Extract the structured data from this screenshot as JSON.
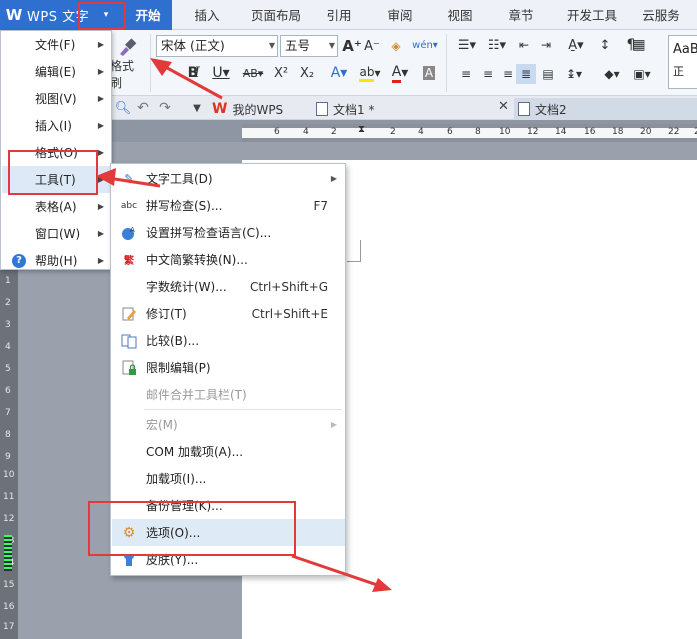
{
  "app": {
    "logo": "W",
    "name": "WPS 文字",
    "menu_arrow": "▾"
  },
  "tabs": [
    "开始",
    "插入",
    "页面布局",
    "引用",
    "审阅",
    "视图",
    "章节",
    "开发工具",
    "云服务"
  ],
  "active_tab": "开始",
  "ribbon": {
    "format_painter_label": "格式刷",
    "font_name": "宋体 (正文)",
    "font_size": "五号",
    "style_preview": "AaB",
    "style_preview_sub": "正"
  },
  "doc_tabs": [
    {
      "label": "我的WPS",
      "icon": "wps-logo-icon"
    },
    {
      "label": "文档1 *",
      "icon": "document-icon"
    },
    {
      "label": "文档2",
      "icon": "document-icon"
    }
  ],
  "ruler_h": [
    "6",
    "4",
    "2",
    "",
    "2",
    "4",
    "6",
    "8",
    "10",
    "12",
    "14",
    "16",
    "18",
    "20",
    "22",
    "24"
  ],
  "ruler_v": [
    "1",
    "2",
    "3",
    "4",
    "5",
    "6",
    "7",
    "8",
    "9",
    "10",
    "11",
    "12",
    "13",
    "14",
    "15",
    "16",
    "17"
  ],
  "app_menu": [
    {
      "label": "文件(F)",
      "submenu": true,
      "icon": ""
    },
    {
      "label": "编辑(E)",
      "submenu": true,
      "icon": ""
    },
    {
      "label": "视图(V)",
      "submenu": true,
      "icon": ""
    },
    {
      "label": "插入(I)",
      "submenu": true,
      "icon": ""
    },
    {
      "label": "格式(O)",
      "submenu": true,
      "icon": ""
    },
    {
      "label": "工具(T)",
      "submenu": true,
      "icon": "",
      "highlighted": true
    },
    {
      "label": "表格(A)",
      "submenu": true,
      "icon": ""
    },
    {
      "label": "窗口(W)",
      "submenu": true,
      "icon": ""
    },
    {
      "label": "帮助(H)",
      "submenu": true,
      "icon": "help-icon"
    }
  ],
  "tools_menu": [
    {
      "label": "文字工具(D)",
      "shortcut": "",
      "submenu": true,
      "icon": "text-tools-icon",
      "disabled": false
    },
    {
      "label": "拼写检查(S)...",
      "shortcut": "F7",
      "submenu": false,
      "icon": "spell-check-icon",
      "disabled": false
    },
    {
      "label": "设置拼写检查语言(C)...",
      "shortcut": "",
      "submenu": false,
      "icon": "language-icon",
      "disabled": false
    },
    {
      "label": "中文简繁转换(N)...",
      "shortcut": "",
      "submenu": false,
      "icon": "chinese-convert-icon",
      "disabled": false
    },
    {
      "label": "字数统计(W)...",
      "shortcut": "Ctrl+Shift+G",
      "submenu": false,
      "icon": "",
      "disabled": false
    },
    {
      "label": "修订(T)",
      "shortcut": "Ctrl+Shift+E",
      "submenu": false,
      "icon": "track-changes-icon",
      "disabled": false
    },
    {
      "label": "比较(B)...",
      "shortcut": "",
      "submenu": false,
      "icon": "compare-icon",
      "disabled": false
    },
    {
      "label": "限制编辑(P)",
      "shortcut": "",
      "submenu": false,
      "icon": "lock-icon",
      "disabled": false
    },
    {
      "label": "邮件合并工具栏(T)",
      "shortcut": "",
      "submenu": false,
      "icon": "",
      "disabled": true
    },
    {
      "label": "宏(M)",
      "shortcut": "",
      "submenu": true,
      "icon": "",
      "disabled": true
    },
    {
      "label": "COM 加载项(A)...",
      "shortcut": "",
      "submenu": false,
      "icon": "",
      "disabled": false
    },
    {
      "label": "加载项(I)...",
      "shortcut": "",
      "submenu": false,
      "icon": "",
      "disabled": false
    },
    {
      "label": "备份管理(K)...",
      "shortcut": "",
      "submenu": false,
      "icon": "",
      "disabled": false
    },
    {
      "label": "选项(O)...",
      "shortcut": "",
      "submenu": false,
      "icon": "gear-icon",
      "disabled": false,
      "highlighted": true
    },
    {
      "label": "皮肤(Y)...",
      "shortcut": "",
      "submenu": false,
      "icon": "skin-icon",
      "disabled": false
    }
  ],
  "colors": {
    "accent": "#2f6fd0",
    "annotation": "#e23a3a",
    "highlight": "#dfeaf7"
  }
}
